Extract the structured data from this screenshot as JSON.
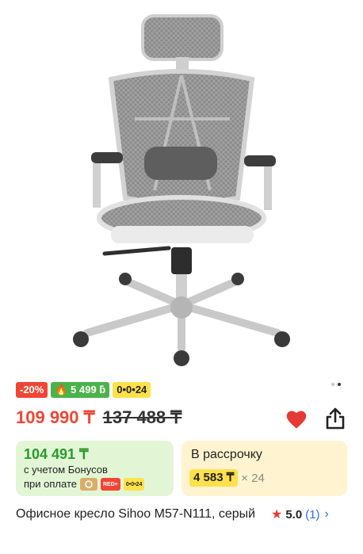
{
  "gallery": {
    "image_alt": "Офисное кресло Sihoo M57-N111, серый",
    "dots": 2,
    "active_dot": 1
  },
  "badges": [
    {
      "text": "-20%",
      "style": "red"
    },
    {
      "text": "🔥 5 499 ƃ",
      "style": "green"
    },
    {
      "text": "0•0•24",
      "style": "yellow"
    }
  ],
  "price": {
    "current": "109 990 ₸",
    "old": "137 488 ₸"
  },
  "actions": {
    "favorite_icon": "heart-icon",
    "share_icon": "share-icon"
  },
  "bonus_card": {
    "amount": "104 491 ₸",
    "line1": "с учетом Бонусов",
    "line2": "при оплате",
    "icons": [
      "gold-card",
      "RED+",
      "0•0•24"
    ]
  },
  "installment_card": {
    "title": "В рассрочку",
    "amount": "4 583 ₸",
    "multiplier": "× 24"
  },
  "product": {
    "title": "Офисное кресло Sihoo M57-N111, серый",
    "rating": "5.0",
    "reviews": "(1)"
  },
  "colors": {
    "discount_red": "#f14635",
    "bonus_green_bg": "#e2f6d5",
    "installment_bg": "#fff4cf",
    "link_blue": "#2b6fe0"
  }
}
